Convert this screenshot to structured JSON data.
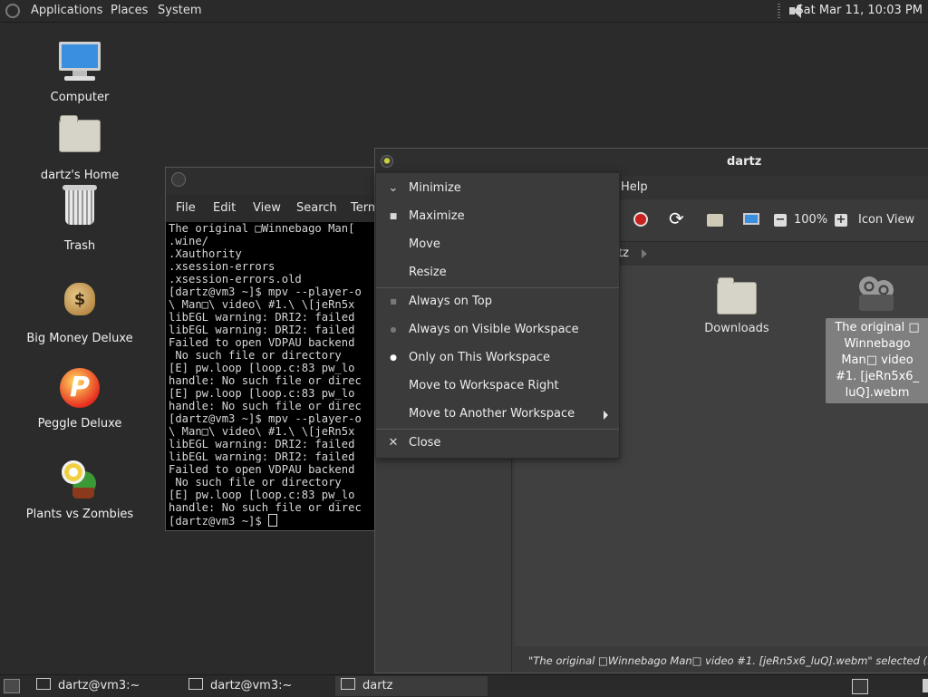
{
  "top_panel": {
    "menus": [
      "Applications",
      "Places",
      "System"
    ],
    "clock": "Sat Mar 11, 10:03 PM",
    "icons": {
      "logo": "distro-logo-icon",
      "volume": "volume-icon"
    }
  },
  "desktop": {
    "icons": [
      {
        "label": "Computer",
        "icon": "computer-icon"
      },
      {
        "label": "dartz's Home",
        "icon": "home-folder-icon"
      },
      {
        "label": "Trash",
        "icon": "trash-icon"
      },
      {
        "label": "Big Money Deluxe",
        "icon": "money-bag-icon"
      },
      {
        "label": "Peggle Deluxe",
        "icon": "peggle-icon"
      },
      {
        "label": "Plants vs Zombies",
        "icon": "plants-vs-zombies-icon"
      }
    ]
  },
  "terminal": {
    "menu": [
      "File",
      "Edit",
      "View",
      "Search",
      "Term"
    ],
    "lines": [
      "The original □Winnebago Man[",
      ".wine/",
      ".Xauthority",
      ".xsession-errors",
      ".xsession-errors.old",
      "[dartz@vm3 ~]$ mpv --player-o",
      "\\ Man□\\ video\\ #1.\\ \\[jeRn5x",
      "libEGL warning: DRI2: failed",
      "libEGL warning: DRI2: failed",
      "Failed to open VDPAU backend",
      " No such file or directory",
      "[E] pw.loop [loop.c:83 pw_lo",
      "handle: No such file or direc",
      "[E] pw.loop [loop.c:83 pw_lo",
      "handle: No such file or direc",
      "[dartz@vm3 ~]$ mpv --player-o",
      "\\ Man□\\ video\\ #1.\\ \\[jeRn5x",
      "libEGL warning: DRI2: failed",
      "libEGL warning: DRI2: failed",
      "Failed to open VDPAU backend",
      " No such file or directory",
      "[E] pw.loop [loop.c:83 pw_lo",
      "handle: No such file or direc"
    ],
    "prompt": "[dartz@vm3 ~]$ "
  },
  "file_manager": {
    "title": "dartz",
    "menu_help": "Help",
    "zoom": "100%",
    "view_mode": "Icon View",
    "breadcrumb": "tz",
    "files": [
      {
        "name": "Downloads",
        "type": "folder"
      },
      {
        "name": "The original □ Winnebago Man□ video #1. [jeRn5x6_ luQ].webm",
        "type": "video",
        "selected": true
      }
    ],
    "status": "\"The original □Winnebago Man□ video #1. [jeRn5x6_luQ].webm\" selected (15.9 MB), Fre"
  },
  "context_menu": {
    "items": [
      {
        "label": "Minimize",
        "icon": "minimize-icon"
      },
      {
        "label": "Maximize",
        "icon": "maximize-icon"
      },
      {
        "label": "Move",
        "icon": ""
      },
      {
        "label": "Resize",
        "icon": ""
      },
      {
        "label": "Always on Top",
        "icon": "checkbox-icon"
      },
      {
        "label": "Always on Visible Workspace",
        "icon": "radio-off-icon"
      },
      {
        "label": "Only on This Workspace",
        "icon": "radio-on-icon"
      },
      {
        "label": "Move to Workspace Right",
        "icon": ""
      },
      {
        "label": "Move to Another Workspace",
        "icon": "",
        "submenu": true
      },
      {
        "label": "Close",
        "icon": "close-icon"
      }
    ]
  },
  "taskbar": {
    "tasks": [
      {
        "label": "dartz@vm3:~",
        "active": false
      },
      {
        "label": "dartz@vm3:~",
        "active": false
      },
      {
        "label": "dartz",
        "active": true
      }
    ]
  }
}
